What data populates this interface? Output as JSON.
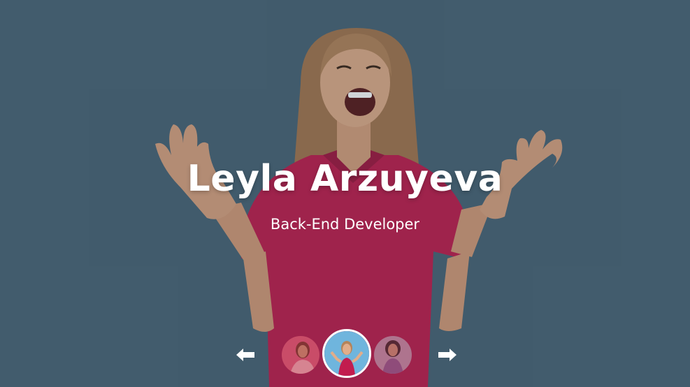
{
  "slider": {
    "name": "Leyla Arzuyeva",
    "role": "Back-End Developer"
  },
  "navigation": {
    "prev_icon": "arrow-left-icon",
    "next_icon": "arrow-right-icon"
  },
  "thumbnails": [
    {
      "icon": "avatar-woman-dark-hair",
      "active": false
    },
    {
      "icon": "avatar-woman-blonde-active",
      "active": true
    },
    {
      "icon": "avatar-woman-curly-hair",
      "active": false
    }
  ],
  "colors": {
    "background": "#4a6577",
    "shirt": "#c21d4e",
    "text": "#ffffff",
    "thumb_active_bg": "#6fb5dd"
  }
}
